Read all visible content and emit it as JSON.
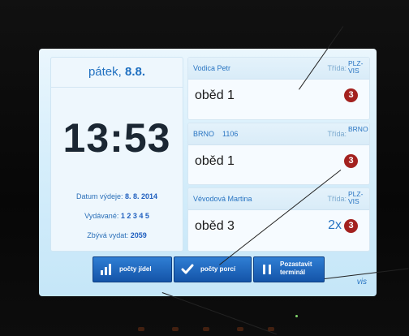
{
  "header": {
    "day": "pátek,",
    "date": "8.8."
  },
  "clock": "13:53",
  "info": {
    "issue_date_label": "Datum výdeje:",
    "issue_date_value": "8. 8. 2014",
    "served_label": "Vydávané:",
    "served_value": "1 2 3 4 5",
    "remaining_label": "Zbývá vydat:",
    "remaining_value": "2059"
  },
  "cards": [
    {
      "name": "Vodica Petr",
      "trida_label": "Třída:",
      "trida_value": "PLZ-VIS",
      "meal": "oběd 1",
      "count": "",
      "badge": "3"
    },
    {
      "name": "BRNO    1106",
      "trida_label": "Třída:",
      "trida_value": "BRNO",
      "meal": "oběd 1",
      "count": "",
      "badge": "3"
    },
    {
      "name": "Vévodová Martina",
      "trida_label": "Třída:",
      "trida_value": "PLZ-VIS",
      "meal": "oběd 3",
      "count": "2x",
      "badge": "3"
    }
  ],
  "buttons": {
    "meal_counts": "počty jídel",
    "portion_counts": "počty porcí",
    "pause_terminal_line1": "Pozastavit",
    "pause_terminal_line2": "terminál"
  },
  "logo": "vis",
  "colors": {
    "accent": "#1e6fc0",
    "badge": "#a3211f",
    "button": "#1f65bd"
  }
}
